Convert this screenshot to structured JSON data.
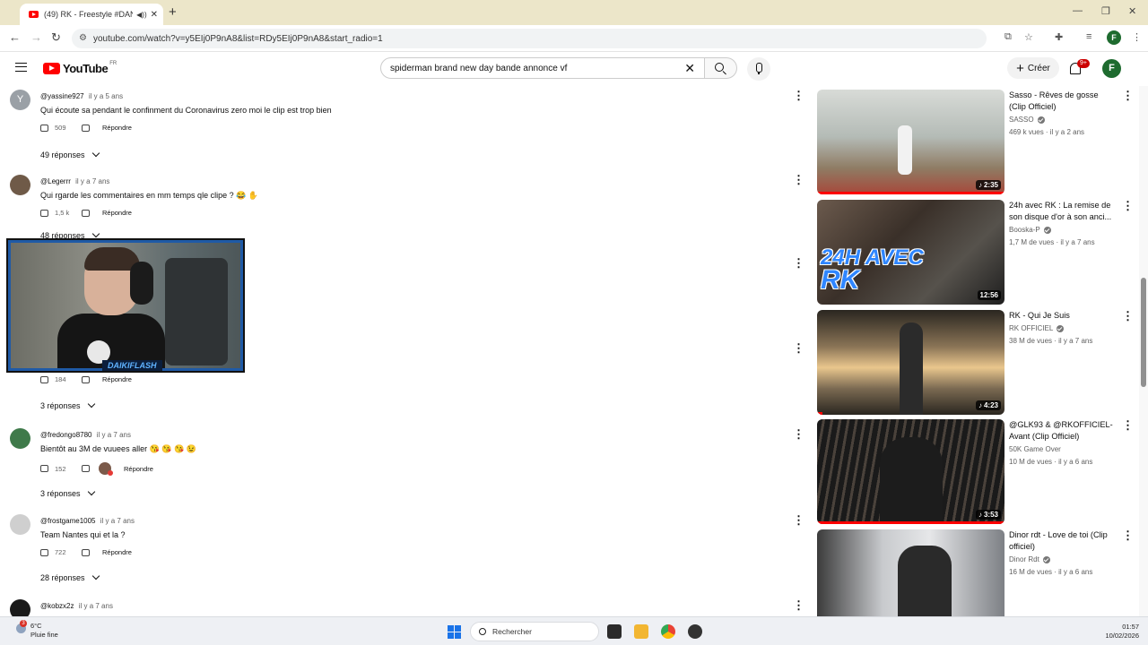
{
  "browser": {
    "tab_title": "(49) RK - Freestyle #DANSL",
    "url": "youtube.com/watch?v=y5EIj0P9nA8&list=RDy5EIj0P9nA8&start_radio=1",
    "profile_letter": "F"
  },
  "youtube": {
    "logo_text": "YouTube",
    "country_code": "FR",
    "search_value": "spiderman brand new day bande annonce vf",
    "create_label": "Créer",
    "notif_count": "9+",
    "avatar_letter": "F"
  },
  "comments": [
    {
      "avatar_letter": "Y",
      "handle": "@yassine927",
      "time": "il y a 5 ans",
      "text": "Qui écoute sa pendant le confinment du Coronavirus zero moi le clip est trop bien",
      "likes": "509",
      "reply_label": "Répondre",
      "replies": "49 réponses"
    },
    {
      "avatar_letter": "",
      "handle": "@Legerrr",
      "time": "il y a 7 ans",
      "text": "Qui rgarde les commentaires en mm temps qle clipe ? 😂 ✋",
      "likes": "1,5 k",
      "reply_label": "Répondre",
      "replies": "48 réponses"
    },
    {
      "likes": "184",
      "reply_label": "Répondre",
      "replies": "3 réponses"
    },
    {
      "avatar_letter": "",
      "handle": "@fredongo8780",
      "time": "il y a 7 ans",
      "text": "Bientôt au 3M de vuuees aller 😘 😘 😘 😉",
      "likes": "152",
      "reply_label": "Répondre",
      "replies": "3 réponses"
    },
    {
      "avatar_letter": "",
      "handle": "@frostgame1005",
      "time": "il y a 7 ans",
      "text": "Team Nantes qui et la ?",
      "likes": "722",
      "reply_label": "Répondre",
      "replies": "28 réponses"
    },
    {
      "avatar_letter": "",
      "handle": "@kobzx2z",
      "time": "il y a 7 ans"
    }
  ],
  "webcam": {
    "tag": "DAIKIFLASH"
  },
  "videos": [
    {
      "title": "Sasso - Rêves de gosse (Clip Officiel)",
      "channel": "SASSO",
      "meta": "469 k vues · il y a 2 ans",
      "duration": "2:35",
      "progress": 1.0,
      "thumb_colors": [
        "#c9ccc6",
        "#8a948c",
        "#b23a2e"
      ]
    },
    {
      "title": "24h avec RK : La remise de son disque d'or à son anci...",
      "channel": "Booska-P",
      "meta": "1,7 M de vues · il y a 7 ans",
      "duration": "12:56",
      "progress": 0.0,
      "thumb_text_1": "24H AVEC",
      "thumb_text_2": "RK",
      "thumb_colors": [
        "#5b4a3e",
        "#2a6fd6",
        "#1c1c1c"
      ]
    },
    {
      "title": "RK - Qui Je Suis",
      "channel": "RK OFFICIEL",
      "meta": "38 M de vues · il y a 7 ans",
      "duration": "4:23",
      "progress": 0.03,
      "thumb_colors": [
        "#e7c48a",
        "#7b6a52",
        "#2a2620"
      ]
    },
    {
      "title": "@GLK93 & @RKOFFICIEL- Avant (Clip Officiel)",
      "channel": "50K Game Over",
      "meta": "10 M de vues · il y a 6 ans",
      "duration": "3:53",
      "progress": 1.0,
      "thumb_colors": [
        "#2b2b2b",
        "#5a5149",
        "#151515"
      ]
    },
    {
      "title": "Dinor rdt - Love de toi (Clip officiel)",
      "channel": "Dinor Rdt",
      "meta": "16 M de vues · il y a 6 ans",
      "duration": "",
      "progress": 0.0,
      "thumb_colors": [
        "#d9dadc",
        "#9aa0a6",
        "#2d2d2d"
      ]
    }
  ],
  "taskbar": {
    "temperature": "6°C",
    "weather": "Pluie fine",
    "weather_badge": "3",
    "search_label": "Rechercher",
    "time": "01:57",
    "date": "10/02/2026"
  }
}
